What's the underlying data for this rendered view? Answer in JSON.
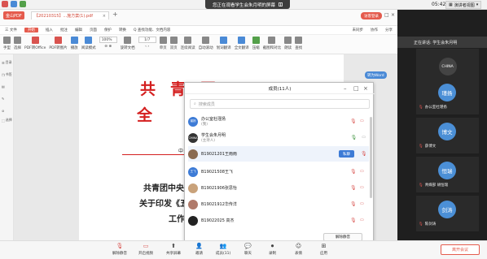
{
  "system_bar": {
    "share_banner": "您正在观看学生会朱月明的屏幕",
    "clock": "05:42",
    "speaker_view": "演讲者视图"
  },
  "wps": {
    "tab_home": "金山PDF",
    "tab_doc": "【20210315】...施方案(1).pdf",
    "login_button": "访客登录",
    "menu": [
      "三 文件",
      "开始",
      "插入",
      "批注",
      "编辑",
      "页面",
      "保护",
      "转换",
      "Q 查找功能、文档内容"
    ],
    "menu_right": [
      "未同步",
      "协作",
      "分享"
    ],
    "toolbar": [
      {
        "label": "手型",
        "color": "gray"
      },
      {
        "label": "选择",
        "color": "gray"
      },
      {
        "label": "PDF转Office",
        "color": "red"
      },
      {
        "label": "PDF转图片",
        "color": "red"
      },
      {
        "label": "播放",
        "color": "blue"
      },
      {
        "label": "阅读模式",
        "color": "blue"
      },
      {
        "label": "旋转文档",
        "color": "gray"
      },
      {
        "label": "单页",
        "color": "gray"
      },
      {
        "label": "双页",
        "color": "gray"
      },
      {
        "label": "连续阅读",
        "color": "gray"
      },
      {
        "label": "自动滚动",
        "color": "gray"
      },
      {
        "label": "划词翻译",
        "color": "blue"
      },
      {
        "label": "全文翻译",
        "color": "blue"
      },
      {
        "label": "压缩",
        "color": "green"
      },
      {
        "label": "截图和对比",
        "color": "gray"
      },
      {
        "label": "朗读",
        "color": "gray"
      },
      {
        "label": "查找",
        "color": "gray"
      }
    ],
    "zoom": "100%",
    "page_indicator": "1/7",
    "sidebar": [
      "目录",
      "书签",
      "缩略图",
      "批注",
      "附件",
      "选择"
    ],
    "to_word": "转为Word"
  },
  "document": {
    "heading1": "共青团",
    "heading2": "全 国",
    "line1": "共青团中央",
    "line2": "关于印发《五",
    "line3": "工作",
    "mid_char": "中"
  },
  "members": {
    "title": "成员(11人)",
    "search_placeholder": "搜索成员",
    "items": [
      {
        "name": "办公室杜瑾扬",
        "sub": "(我)",
        "avatar_text": "瑾扬",
        "avatar_color": "#3d7bd6",
        "mic": "off",
        "cam": "off"
      },
      {
        "name": "学生会朱月明",
        "sub": "(主持人)",
        "avatar_text": "CHINA",
        "avatar_color": "#333333",
        "mic": "on",
        "cam": "on"
      },
      {
        "name": "B19021201王雨雨",
        "sub": "",
        "avatar_text": "",
        "avatar_color": "#8a6a50",
        "mic": "off",
        "cam": "off",
        "private_chat": "私聊"
      },
      {
        "name": "B19021508王飞",
        "sub": "",
        "avatar_text": "王飞",
        "avatar_color": "#3d7bd6",
        "mic": "off",
        "cam": "off"
      },
      {
        "name": "B19021906张思怡",
        "sub": "",
        "avatar_text": "",
        "avatar_color": "#c9a27a",
        "mic": "off",
        "cam": "off"
      },
      {
        "name": "B19021912华传洋",
        "sub": "",
        "avatar_text": "",
        "avatar_color": "#b07a6a",
        "mic": "off",
        "cam": "off"
      },
      {
        "name": "B19022025 高杰",
        "sub": "",
        "avatar_text": "",
        "avatar_color": "#222222",
        "mic": "off",
        "cam": "off"
      }
    ],
    "mute_all": "解除静音"
  },
  "bottom_bar": {
    "items": [
      "解除静音",
      "开启视频",
      "共享屏幕",
      "邀请",
      "成员(11)",
      "聊天",
      "录制",
      "表情",
      "应用"
    ],
    "leave": "离开会议"
  },
  "right_panel": {
    "speaking": "正在讲话: 学生会朱月明",
    "thumbs": [
      {
        "label": "CHINA",
        "name": ""
      },
      {
        "label": "瑾扬",
        "name": "办公室杜瑾扬"
      },
      {
        "label": "博文",
        "name": "薛博文"
      },
      {
        "label": "恒瑞",
        "name": "青媒部 胡恒瑞"
      },
      {
        "label": "剑涛",
        "name": "陈剑涛"
      }
    ]
  },
  "colors": {
    "accent_red": "#e55b4d",
    "accent_blue": "#3d7bd6",
    "doc_red": "#d41f1f"
  }
}
